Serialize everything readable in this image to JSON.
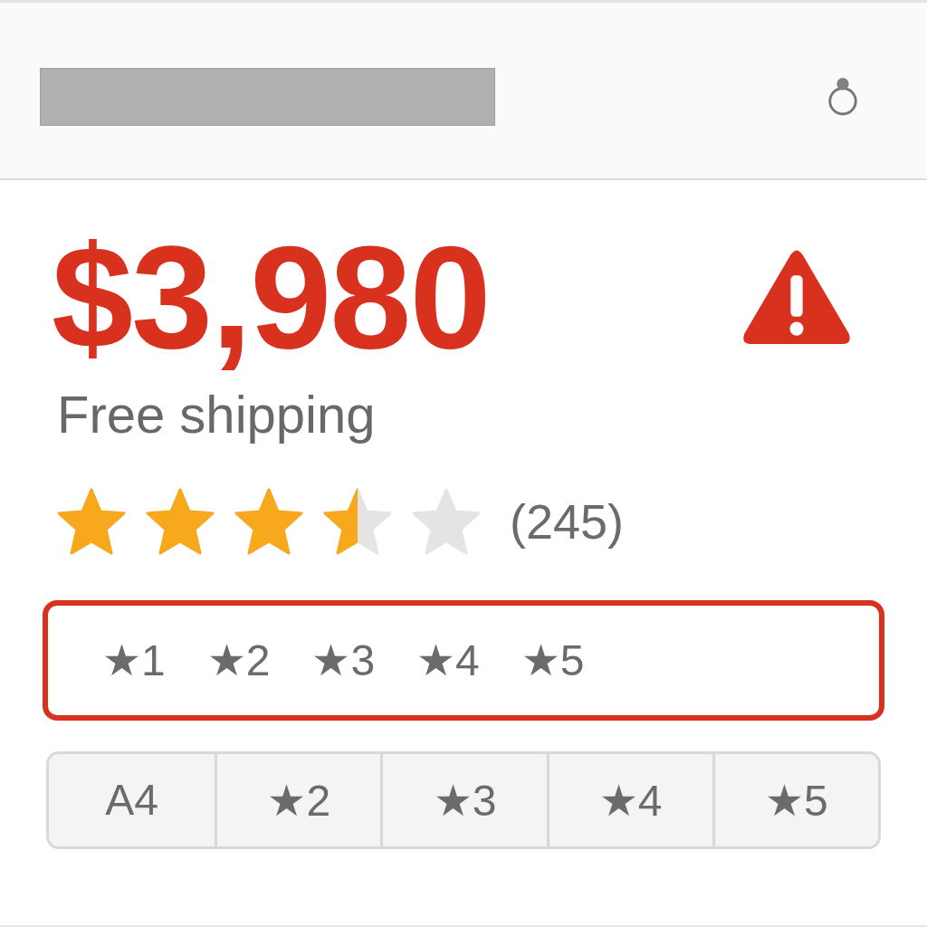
{
  "price": "$3,980",
  "shipping": "Free shipping",
  "rating": {
    "stars": 3.5,
    "count": "(245)"
  },
  "star_filter": {
    "error": true,
    "options": [
      "★1",
      "★2",
      "★3",
      "★4",
      "★5"
    ]
  },
  "segments": [
    {
      "label": "A4",
      "selected": false
    },
    {
      "label": "★2",
      "selected": false
    },
    {
      "label": "★3",
      "selected": false
    },
    {
      "label": "★4",
      "selected": false
    },
    {
      "label": "★5",
      "selected": false
    }
  ]
}
